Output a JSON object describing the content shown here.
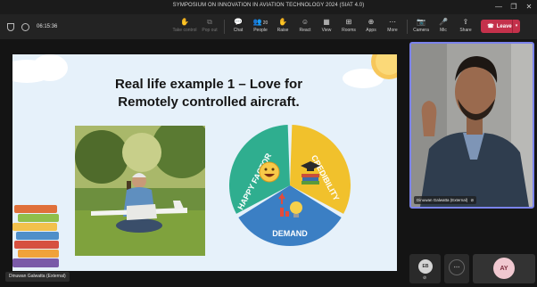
{
  "window": {
    "title": "SYMPOSIUM ON INNOVATION IN AVIATION TECHNOLOGY 2024 (SIAT 4.0)"
  },
  "toolbar": {
    "meeting_time": "06:15:36",
    "buttons": [
      {
        "label": "Take control",
        "icon": "hand-icon",
        "glyph": "✋"
      },
      {
        "label": "Pop out",
        "icon": "popout-icon",
        "glyph": "⧉"
      },
      {
        "label": "Chat",
        "icon": "chat-icon",
        "glyph": "💬"
      },
      {
        "label": "People",
        "icon": "people-icon",
        "glyph": "👥",
        "badge": "20"
      },
      {
        "label": "Raise",
        "icon": "raise-hand-icon",
        "glyph": "✋"
      },
      {
        "label": "React",
        "icon": "react-icon",
        "glyph": "☺"
      },
      {
        "label": "View",
        "icon": "view-icon",
        "glyph": "▦"
      },
      {
        "label": "Rooms",
        "icon": "rooms-icon",
        "glyph": "⊞"
      },
      {
        "label": "Apps",
        "icon": "apps-icon",
        "glyph": "⊕"
      },
      {
        "label": "More",
        "icon": "more-icon",
        "glyph": "⋯"
      },
      {
        "label": "Camera",
        "icon": "camera-icon",
        "glyph": "📷"
      },
      {
        "label": "Mic",
        "icon": "mic-icon",
        "glyph": "🎤"
      },
      {
        "label": "Share",
        "icon": "share-icon",
        "glyph": "⇪"
      }
    ],
    "leave_label": "Leave"
  },
  "slide": {
    "title_line1": "Real life example 1 – Love for",
    "title_line2": "Remotely controlled aircraft.",
    "segments": [
      "HAPPY FACTOR",
      "CREDIBILITY",
      "DEMAND"
    ],
    "segment_colors": [
      "#2fae8f",
      "#f1c12c",
      "#3b7fc4"
    ]
  },
  "presenter_caption": "Dinuwan Galwatta (External)",
  "video": {
    "caption": "Dinuwan Galwatta (External)"
  },
  "participants": [
    {
      "initials": "EB"
    },
    {
      "initials": "AY"
    }
  ],
  "colors": {
    "accent": "#7b83eb",
    "leave": "#c4314b"
  }
}
